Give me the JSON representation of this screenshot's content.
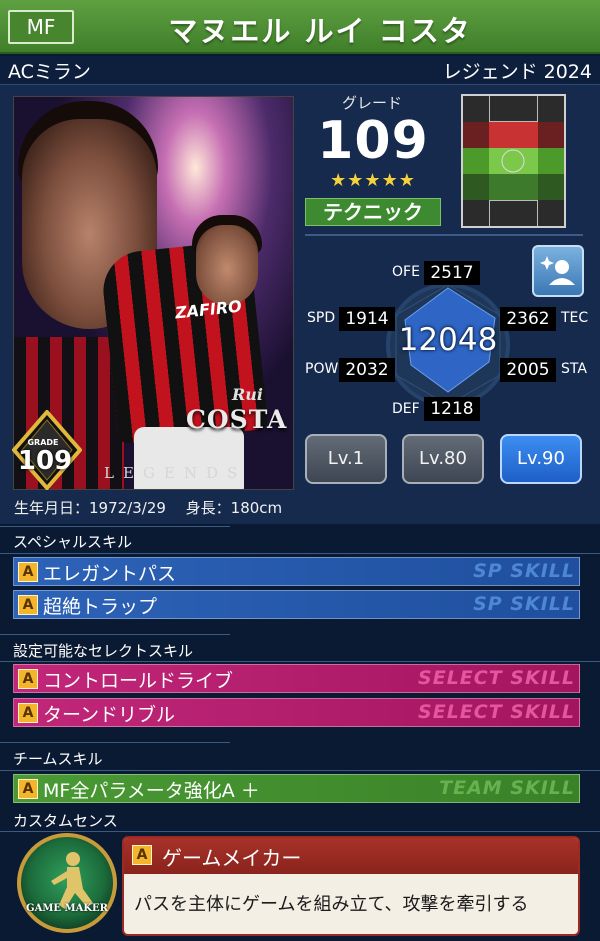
{
  "header": {
    "position": "MF",
    "player_name": "マヌエル ルイ コスタ",
    "club": "ACミラン",
    "edition": "レジェンド 2024"
  },
  "card": {
    "sponsor": "ZAFIRO",
    "first_name": "Rui",
    "last_name": "COSTA",
    "series": "LEGENDS",
    "grade_label": "GRADE",
    "grade_value": "109"
  },
  "grade": {
    "caption": "グレード",
    "value": "109",
    "stars": "★★★★★",
    "type": "テクニック"
  },
  "stats": {
    "ofe": {
      "label": "OFE",
      "value": "2517"
    },
    "spd": {
      "label": "SPD",
      "value": "1914"
    },
    "tec": {
      "label": "TEC",
      "value": "2362"
    },
    "pow": {
      "label": "POW",
      "value": "2032"
    },
    "sta": {
      "label": "STA",
      "value": "2005"
    },
    "def": {
      "label": "DEF",
      "value": "1218"
    },
    "total": "12048"
  },
  "levels": [
    "Lv.1",
    "Lv.80",
    "Lv.90"
  ],
  "profile": "生年月日：1972/3/29　 身長：180cm",
  "sp_skills": {
    "title": "スペシャルスキル",
    "tag": "SP SKILL",
    "items": [
      {
        "rank": "A",
        "name": "エレガントパス"
      },
      {
        "rank": "A",
        "name": "超絶トラップ"
      }
    ]
  },
  "select_skills": {
    "title": "設定可能なセレクトスキル",
    "tag": "SELECT SKILL",
    "items": [
      {
        "rank": "A",
        "name": "コントロールドライブ"
      },
      {
        "rank": "A",
        "name": "ターンドリブル"
      }
    ]
  },
  "team_skills": {
    "title": "チームスキル",
    "tag": "TEAM SKILL",
    "items": [
      {
        "rank": "A",
        "name": "MF全パラメータ強化A ＋"
      }
    ]
  },
  "custom_sense": {
    "title": "カスタムセンス",
    "emblem": "GAME MAKER",
    "rank": "A",
    "name": "ゲームメイカー",
    "description": "パスを主体にゲームを組み立て、攻撃を牽引する"
  }
}
